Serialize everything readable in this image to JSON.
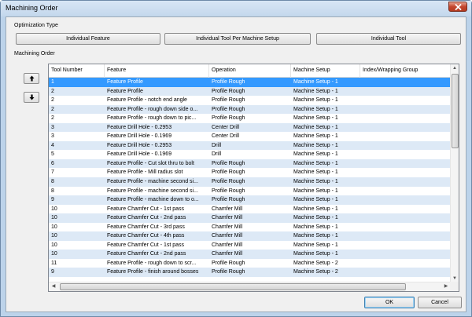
{
  "window": {
    "title": "Machining Order"
  },
  "optimization": {
    "label": "Optimization Type",
    "buttons": [
      "Individual Feature",
      "Individual Tool Per Machine Setup",
      "Individual Tool"
    ]
  },
  "order": {
    "label": "Machining Order",
    "up_arrow": "↑",
    "down_arrow": "↓"
  },
  "table": {
    "columns": [
      "Tool Number",
      "Feature",
      "Operation",
      "Machine Setup",
      "Index/Wrapping Group"
    ],
    "rows": [
      [
        "1",
        "Feature Profile",
        "Profile Rough",
        "Machine Setup - 1",
        ""
      ],
      [
        "2",
        "Feature Profile",
        "Profile Rough",
        "Machine Setup - 1",
        ""
      ],
      [
        "2",
        "Feature Profile - notch end angle",
        "Profile Rough",
        "Machine Setup - 1",
        ""
      ],
      [
        "2",
        "Feature Profile - rough down side o...",
        "Profile Rough",
        "Machine Setup - 1",
        ""
      ],
      [
        "2",
        "Feature Profile - rough down to pic...",
        "Profile Rough",
        "Machine Setup - 1",
        ""
      ],
      [
        "3",
        "Feature Drill Hole - 0.2953",
        "Center Drill",
        "Machine Setup - 1",
        ""
      ],
      [
        "3",
        "Feature Drill Hole - 0.1969",
        "Center Drill",
        "Machine Setup - 1",
        ""
      ],
      [
        "4",
        "Feature Drill Hole - 0.2953",
        "Drill",
        "Machine Setup - 1",
        ""
      ],
      [
        "5",
        "Feature Drill Hole - 0.1969",
        "Drill",
        "Machine Setup - 1",
        ""
      ],
      [
        "6",
        "Feature Profile - Cut slot thru to bolt",
        "Profile Rough",
        "Machine Setup - 1",
        ""
      ],
      [
        "7",
        "Feature Profile - Mill radius slot",
        "Profile Rough",
        "Machine Setup - 1",
        ""
      ],
      [
        "8",
        "Feature Profile - machine second si...",
        "Profile Rough",
        "Machine Setup - 1",
        ""
      ],
      [
        "8",
        "Feature Profile - machine second si...",
        "Profile Rough",
        "Machine Setup - 1",
        ""
      ],
      [
        "9",
        "Feature Profile - machine down to o...",
        "Profile Rough",
        "Machine Setup - 1",
        ""
      ],
      [
        "10",
        "Feature Chamfer Cut - 1st pass",
        "Chamfer Mill",
        "Machine Setup - 1",
        ""
      ],
      [
        "10",
        "Feature Chamfer Cut - 2nd pass",
        "Chamfer Mill",
        "Machine Setup - 1",
        ""
      ],
      [
        "10",
        "Feature Chamfer Cut - 3rd pass",
        "Chamfer Mill",
        "Machine Setup - 1",
        ""
      ],
      [
        "10",
        "Feature Chamfer Cut - 4th pass",
        "Chamfer Mill",
        "Machine Setup - 1",
        ""
      ],
      [
        "10",
        "Feature Chamfer Cut - 1st pass",
        "Chamfer Mill",
        "Machine Setup - 1",
        ""
      ],
      [
        "10",
        "Feature Chamfer Cut - 2nd pass",
        "Chamfer Mill",
        "Machine Setup - 1",
        ""
      ],
      [
        "11",
        "Feature Profile - rough down to scr...",
        "Profile Rough",
        "Machine Setup - 2",
        ""
      ],
      [
        "9",
        "Feature Profile - finish around bosses",
        "Profile Rough",
        "Machine Setup - 2",
        ""
      ]
    ],
    "selected_row": 0
  },
  "footer": {
    "ok": "OK",
    "cancel": "Cancel"
  },
  "colors": {
    "selection": "#3399ff",
    "alt_row": "#dde9f6",
    "frame": "#bcd3ea",
    "close": "#c4462d"
  },
  "icons": {
    "close": "close-icon",
    "up": "arrow-up-icon",
    "down": "arrow-down-icon"
  }
}
